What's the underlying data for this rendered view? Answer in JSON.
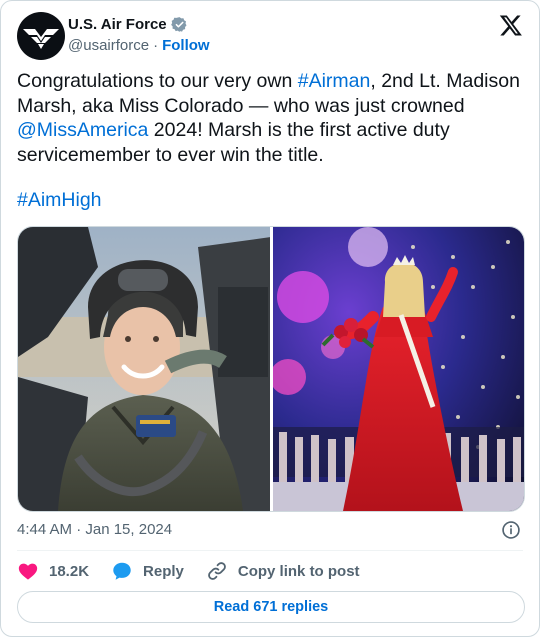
{
  "author": {
    "display_name": "U.S. Air Force",
    "handle": "@usairforce",
    "separator": "·",
    "follow_label": "Follow"
  },
  "tweet": {
    "text_parts": [
      "Congratulations to our very own ",
      "#Airman",
      ", 2nd Lt. Madison Marsh, aka Miss Colorado — who was just crowned ",
      "@MissAmerica",
      " 2024! Marsh is the first active duty servicemember to ever win the title."
    ],
    "hashtag": "#AimHigh",
    "timestamp": "4:44 AM · Jan 15, 2024"
  },
  "media": [
    {
      "icon": "photo-pilot-in-cockpit"
    },
    {
      "icon": "photo-miss-america-crowning"
    }
  ],
  "actions": {
    "likes": "18.2K",
    "reply_label": "Reply",
    "copy_label": "Copy link to post"
  },
  "read_replies_label": "Read 671 replies",
  "colors": {
    "link": "#006fd6",
    "verified": "#829aab",
    "like": "#f91880",
    "reply": "#1d9bf0",
    "muted": "#536471"
  }
}
